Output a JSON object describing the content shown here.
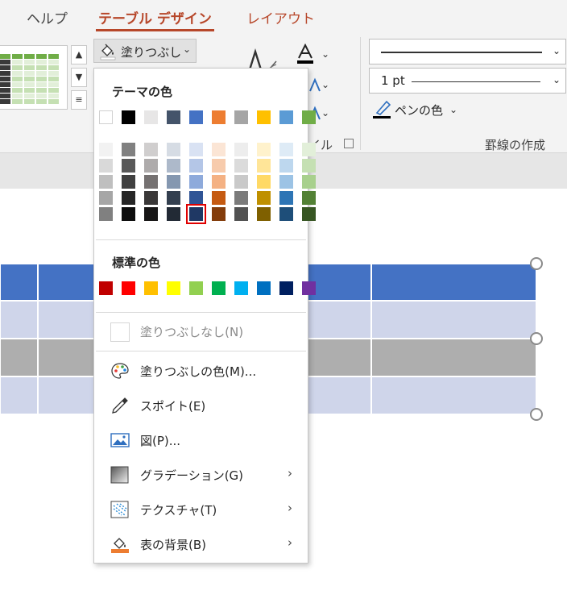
{
  "tabs": {
    "help": "ヘルプ",
    "table_design": "テーブル デザイン",
    "layout": "レイアウト"
  },
  "ribbon": {
    "fill_button": "塗りつぶし",
    "group_wordart_partial": "イル",
    "line_width": "1 pt",
    "pen_color": "ペンの色",
    "group_borders": "罫線の作成"
  },
  "menu": {
    "theme_colors_title": "テーマの色",
    "standard_colors_title": "標準の色",
    "no_fill": "塗りつぶしなし(N)",
    "more_colors": "塗りつぶしの色(M)...",
    "eyedropper": "スポイト(E)",
    "picture": "図(P)...",
    "gradient": "グラデーション(G)",
    "texture": "テクスチャ(T)",
    "table_background": "表の背景(B)",
    "theme_colors_top": [
      "#ffffff",
      "#000000",
      "#e7e6e6",
      "#44546a",
      "#4472c4",
      "#ed7d31",
      "#a5a5a5",
      "#ffc000",
      "#5b9bd5",
      "#70ad47"
    ],
    "theme_shades": [
      [
        "#f2f2f2",
        "#d9d9d9",
        "#bfbfbf",
        "#a6a6a6",
        "#808080"
      ],
      [
        "#808080",
        "#595959",
        "#404040",
        "#262626",
        "#0d0d0d"
      ],
      [
        "#d0cece",
        "#aeabab",
        "#757171",
        "#3a3838",
        "#171616"
      ],
      [
        "#d6dce4",
        "#adb9ca",
        "#8497b0",
        "#333f4f",
        "#222a35"
      ],
      [
        "#d9e2f3",
        "#b4c6e7",
        "#8eaadb",
        "#2f5496",
        "#1f3864"
      ],
      [
        "#fbe5d5",
        "#f7cbac",
        "#f4b183",
        "#c55a11",
        "#833c0b"
      ],
      [
        "#ededed",
        "#dbdbdb",
        "#c9c9c9",
        "#7b7b7b",
        "#525252"
      ],
      [
        "#fff2cc",
        "#ffe598",
        "#ffd965",
        "#bf9000",
        "#7f6000"
      ],
      [
        "#deebf6",
        "#bdd7ee",
        "#9cc3e5",
        "#2e75b5",
        "#1e4e79"
      ],
      [
        "#e2efd9",
        "#c5e0b3",
        "#a8d08d",
        "#538135",
        "#375623"
      ]
    ],
    "standard_colors": [
      "#c00000",
      "#ff0000",
      "#ffc000",
      "#ffff00",
      "#92d050",
      "#00b050",
      "#00b0f0",
      "#0070c0",
      "#002060",
      "#7030a0"
    ],
    "selected_color": "#1f3864"
  },
  "colors": {
    "accent": "#b7472a",
    "table_header": "#4472c4",
    "table_band_light": "#cfd5ea",
    "table_band_dark": "#aeaeae"
  }
}
